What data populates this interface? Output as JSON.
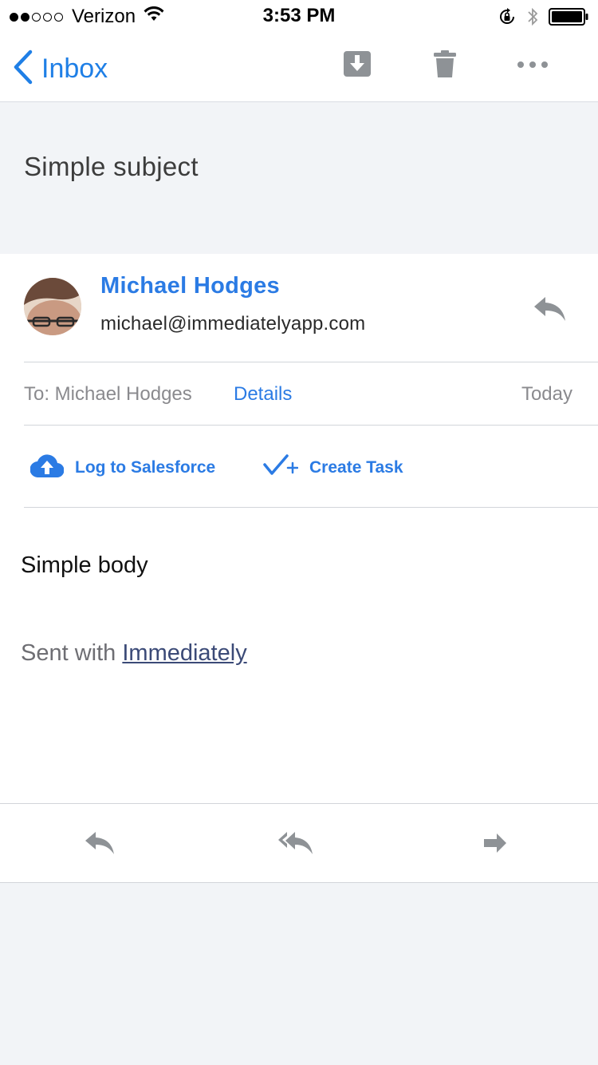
{
  "status_bar": {
    "carrier": "Verizon",
    "time": "3:53 PM",
    "signal_bars_filled": 2,
    "signal_bars_total": 5
  },
  "nav": {
    "back_label": "Inbox",
    "icons": [
      "archive-icon",
      "trash-icon",
      "more-icon"
    ]
  },
  "email": {
    "subject": "Simple subject",
    "sender_name": "Michael Hodges",
    "sender_email": "michael@immediatelyapp.com",
    "to_line": "To: Michael Hodges",
    "details_label": "Details",
    "date": "Today",
    "body": "Simple body",
    "signature_prefix": "Sent with",
    "signature_link": "Immediately"
  },
  "actions": {
    "log_salesforce": "Log to Salesforce",
    "create_task": "Create Task"
  },
  "colors": {
    "accent": "#2b7be4",
    "icon_gray": "#8e9296",
    "background": "#f2f4f7"
  }
}
